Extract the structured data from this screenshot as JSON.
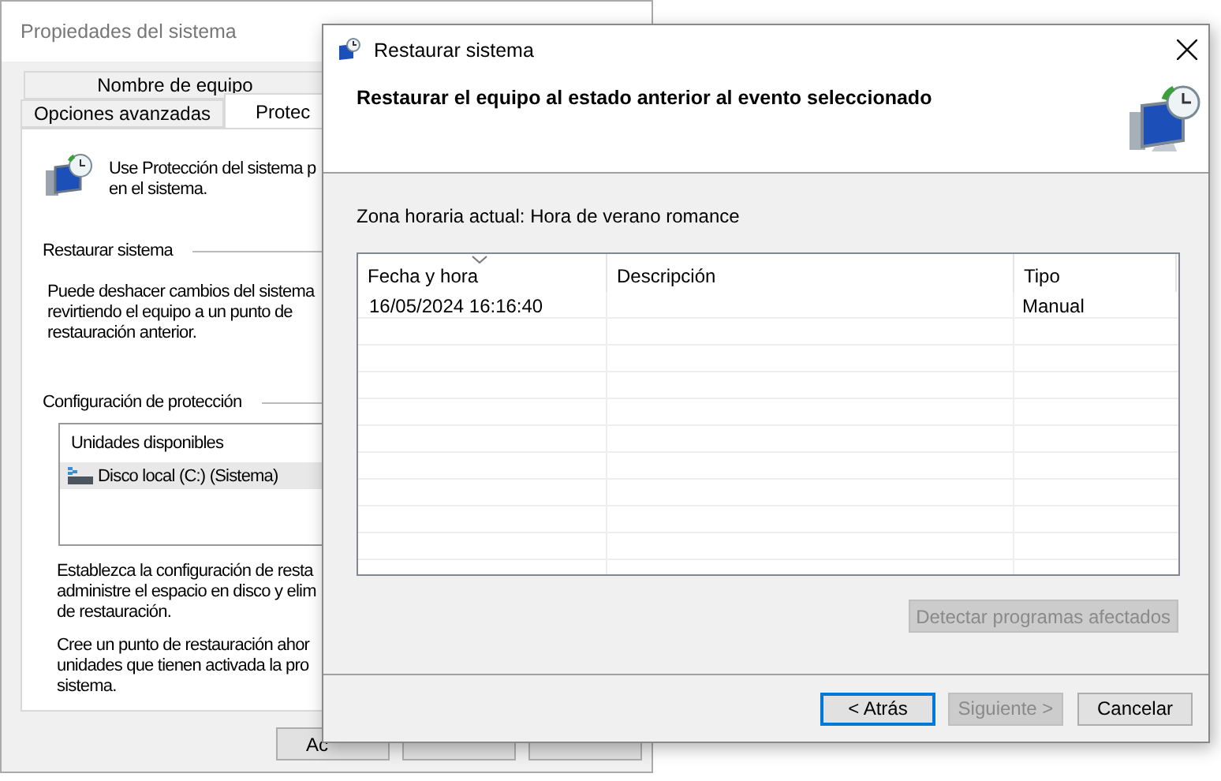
{
  "back_window": {
    "title": "Propiedades del sistema",
    "tab_rows": [
      {
        "tabs": [
          {
            "label": "Nombre de equipo",
            "selected": false
          }
        ]
      },
      {
        "tabs": [
          {
            "label": "Opciones avanzadas",
            "selected": false
          },
          {
            "label": "Protec",
            "selected": true
          }
        ]
      }
    ],
    "intro": [
      "Use Protección del sistema p",
      "en el sistema."
    ],
    "restore_section": {
      "heading": "Restaurar sistema",
      "text": [
        "Puede deshacer cambios del sistema",
        "revirtiendo el equipo a un punto de",
        "restauración anterior."
      ]
    },
    "protection_section": {
      "heading": "Configuración de protección",
      "list_header": "Unidades disponibles",
      "drives": [
        {
          "label": "Disco local (C:) (Sistema)",
          "selected": true
        }
      ],
      "text_1": [
        "Establezca la configuración de resta",
        "administre el espacio en disco y elim",
        "de restauración."
      ],
      "text_2": [
        "Cree un punto de restauración ahor",
        "unidades que tienen activada la pro",
        "sistema."
      ]
    },
    "buttons": [
      {
        "label": "Ac"
      }
    ]
  },
  "dialog": {
    "title": "Restaurar sistema",
    "heading": "Restaurar el equipo al estado anterior al evento seleccionado",
    "timezone": "Zona horaria actual: Hora de verano romance",
    "table": {
      "columns": [
        {
          "label": "Fecha y hora",
          "sorted": true
        },
        {
          "label": "Descripción",
          "sorted": false
        },
        {
          "label": "Tipo",
          "sorted": false
        }
      ],
      "rows": [
        [
          "16/05/2024 16:16:40",
          "",
          "Manual"
        ]
      ]
    },
    "detect_button": {
      "label": "Detectar programas afectados",
      "disabled": true
    },
    "buttons": [
      {
        "label": "< Atrás",
        "disabled": false,
        "focused": true
      },
      {
        "label": "Siguiente >",
        "disabled": true,
        "focused": false
      },
      {
        "label": "Cancelar",
        "disabled": false,
        "focused": false
      }
    ]
  }
}
